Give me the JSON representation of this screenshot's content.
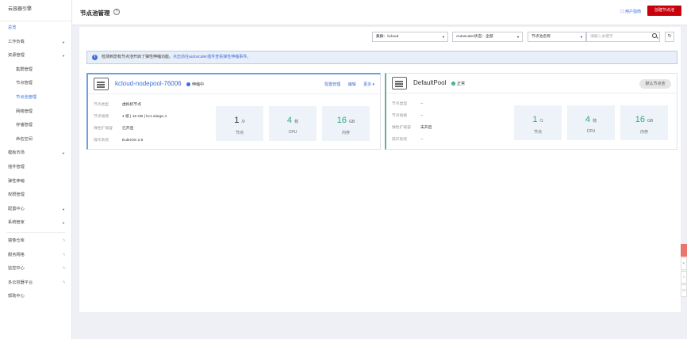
{
  "sidebar": {
    "title": "云容器引擎",
    "items": [
      {
        "label": "总览",
        "active": true
      },
      {
        "label": "工作负载",
        "arrow": true
      },
      {
        "label": "资源管理",
        "arrow": true
      },
      {
        "label": "集群管理",
        "sub": true
      },
      {
        "label": "节点管理",
        "sub": true
      },
      {
        "label": "节点池管理",
        "sub": true,
        "active": true
      },
      {
        "label": "网络管理",
        "sub": true
      },
      {
        "label": "存储管理",
        "sub": true
      },
      {
        "label": "命名空间",
        "sub": true
      },
      {
        "label": "模板市场",
        "arrow": true
      },
      {
        "label": "插件管理"
      },
      {
        "label": "弹性伸缩"
      },
      {
        "label": "权限管理"
      },
      {
        "label": "配置中心",
        "arrow": true
      },
      {
        "label": "系统管家",
        "arrow": true
      },
      {
        "label": "镜像仓库",
        "pin": true
      },
      {
        "label": "服务网格",
        "pin": true
      },
      {
        "label": "监控中心",
        "pin": true
      },
      {
        "label": "多云容器平台",
        "pin": true
      },
      {
        "label": "帮助中心"
      }
    ]
  },
  "header": {
    "title": "节点池管理",
    "help_icon": "?",
    "user_guide": "用户指南",
    "create_button": "创建节点池"
  },
  "filters": {
    "cluster": "集群：kcloud",
    "autoscaler": "Autoscaler状态：全部",
    "attribute": "节点池名称",
    "search_placeholder": "请输入关键字",
    "refresh_icon": "↻"
  },
  "info": {
    "icon": "i",
    "text": "检测到您有节点池开启了弹性伸缩功能。",
    "link": "点击前往autoscaler插件查看弹性伸缩事件。"
  },
  "cards": [
    {
      "name": "kcloud-nodepool-76006",
      "status": "伸缩中",
      "status_color": "#3a6fd8",
      "links": {
        "config": "配置管理",
        "edit": "编辑",
        "more": "更多 ▾"
      },
      "props": [
        {
          "k": "节点类型",
          "v": "虚拟机节点"
        },
        {
          "k": "节点规格",
          "v": "4 核 | 16 GB | kc1.xlarge.4"
        },
        {
          "k": "弹性扩缩容",
          "v": "已开启"
        },
        {
          "k": "操作系统",
          "v": "EulerOS 2.8"
        }
      ],
      "stats": [
        {
          "num": "1",
          "unit": "/0",
          "label": "节点"
        },
        {
          "num": "4",
          "unit": "核",
          "label": "CPU"
        },
        {
          "num": "16",
          "unit": "GB",
          "label": "内存"
        }
      ]
    },
    {
      "name": "DefaultPool",
      "status": "正常",
      "status_color": "#2ea985",
      "default_label": "默认节点池",
      "props": [
        {
          "k": "节点类型",
          "v": "--"
        },
        {
          "k": "节点规格",
          "v": "--"
        },
        {
          "k": "弹性扩缩容",
          "v": "未开启"
        },
        {
          "k": "操作系统",
          "v": "--"
        }
      ],
      "stats": [
        {
          "num": "1",
          "unit": "/1",
          "label": "节点"
        },
        {
          "num": "4",
          "unit": "核",
          "label": "CPU"
        },
        {
          "num": "16",
          "unit": "GB",
          "label": "内存"
        }
      ]
    }
  ]
}
